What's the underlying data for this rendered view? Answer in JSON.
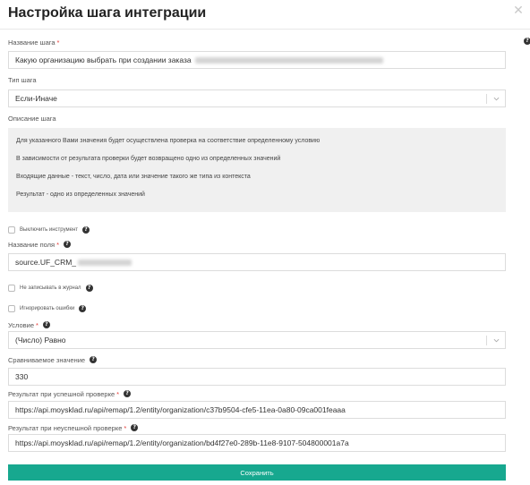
{
  "title": "Настройка шага интеграции",
  "step_name": {
    "label": "Название шага",
    "required_mark": "*",
    "value": "Какую организацию выбрать при создании заказа"
  },
  "step_type": {
    "label": "Тип шага",
    "value": "Если-Иначе"
  },
  "description": {
    "label": "Описание шага",
    "lines": [
      "Для указанного Вами значения будет осуществлена проверка на соответствие определенному условию",
      "В зависимости от результата проверки будет возвращено одно из определенных значений",
      "Входящие данные - текст, число, дата или значение такого же типа из контекста",
      "Результат - одно из определенных значений"
    ]
  },
  "disable_tool": {
    "label": "Выключить инструмент",
    "checked": false
  },
  "field_name": {
    "label": "Название поля",
    "required_mark": "*",
    "value": "source.UF_CRM_"
  },
  "no_log": {
    "label": "Не записывать в журнал",
    "checked": false
  },
  "ignore_errors": {
    "label": "Игнорировать ошибки",
    "checked": false
  },
  "condition": {
    "label": "Условие",
    "required_mark": "*",
    "value": "(Число) Равно"
  },
  "compare_value": {
    "label": "Сравниваемое значение",
    "value": "330"
  },
  "success_result": {
    "label": "Результат при успешной проверке",
    "required_mark": "*",
    "value": "https://api.moysklad.ru/api/remap/1.2/entity/organization/c37b9504-cfe5-11ea-0a80-09ca001feaaa"
  },
  "fail_result": {
    "label": "Результат при неуспешной проверке",
    "required_mark": "*",
    "value": "https://api.moysklad.ru/api/remap/1.2/entity/organization/bd4f27e0-289b-11e8-9107-504800001a7a"
  },
  "save_label": "Сохранить",
  "icons": {
    "close": "close-icon",
    "help": "question-icon",
    "chevron": "chevron-down-icon"
  },
  "colors": {
    "accent": "#17a88f",
    "required": "#e53935",
    "description_bg": "#f0f0f0"
  }
}
